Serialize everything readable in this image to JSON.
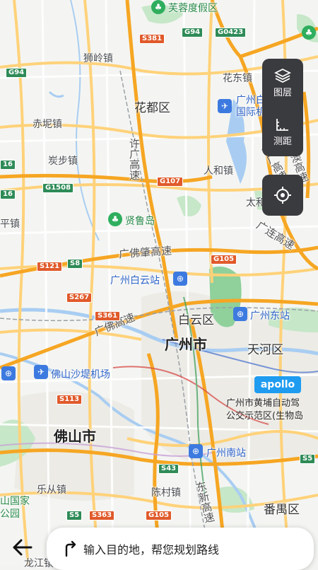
{
  "map": {
    "districts": {
      "huadu": "花都区",
      "baiyun": "白云区",
      "tianhe": "天河区",
      "panyu": "番禺区",
      "guangzhou_city": "广州市",
      "foshan_city": "佛山市"
    },
    "towns": {
      "shiling": "狮岭镇",
      "chini": "赤坭镇",
      "tanbu": "炭步镇",
      "huadong": "花东镇",
      "renhe": "人和镇",
      "taihe": "太和镇",
      "lecong": "乐从镇",
      "chencun": "陈村镇",
      "pingzhen": "平镇",
      "longjiang": "龙江镇"
    },
    "pois": {
      "furong": "芙蓉度假区",
      "xianlu": "贤鲁岛",
      "national_park": "山国家公园"
    },
    "transport": {
      "baiyun_airport": "广州白云国际机场",
      "baiyun_station": "广州白云站",
      "east_station": "广州东站",
      "foshan_airport": "佛山沙堤机场",
      "south_station": "广州南站"
    },
    "roads": {
      "xuguang": "许广高速",
      "guangfozhao": "广佛肇高速",
      "guangfo": "广佛高速",
      "guanglian": "广连高速",
      "dongxin": "东新高速",
      "jinggang": "京港澳高速",
      "daguang": "大广高速"
    },
    "route_badges": {
      "S381": "S381",
      "G94": "G94",
      "G0423": "G0423",
      "G107": "G107",
      "G1508": "G1508",
      "S121": "S121",
      "S8": "S8",
      "S267": "S267",
      "S361": "S361",
      "G105": "G105",
      "S113": "S113",
      "S43": "S43",
      "S5": "S5",
      "S363": "S363",
      "G94b": "G94",
      "n16": "16",
      "n16b": "16",
      "G105b": "G105"
    },
    "apollo": {
      "logo": "apollo",
      "line1": "广州市黄埔自动驾",
      "line2": "公交示范区(生物岛"
    }
  },
  "controls": {
    "layers_label": "图层",
    "measure_label": "测距"
  },
  "search": {
    "placeholder": "输入目的地，帮您规划路线"
  },
  "colors": {
    "highway": "#f6a623",
    "major_road": "#ffd27a",
    "water": "#a9cdf2",
    "green": "#c6e7c8",
    "urban": "#eceae5"
  }
}
